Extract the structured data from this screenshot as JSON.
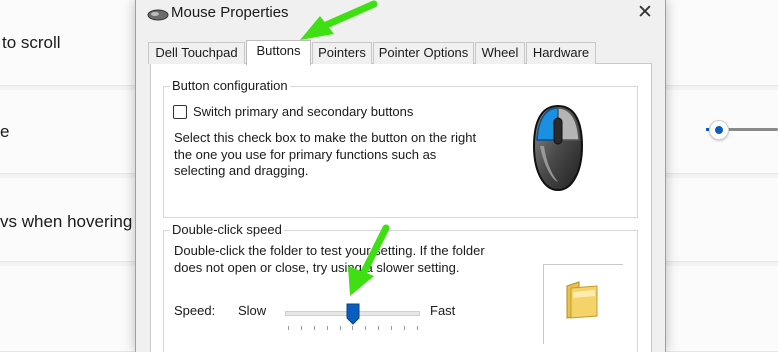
{
  "background": {
    "row1_text": "to scroll",
    "row2_text": "e",
    "row3_text": "vs when hovering o"
  },
  "dialog": {
    "title": "Mouse Properties",
    "close_label": "✕",
    "tabs": [
      {
        "label": "Dell Touchpad"
      },
      {
        "label": "Buttons"
      },
      {
        "label": "Pointers"
      },
      {
        "label": "Pointer Options"
      },
      {
        "label": "Wheel"
      },
      {
        "label": "Hardware"
      }
    ],
    "active_tab": "Buttons",
    "button_config": {
      "group_label": "Button configuration",
      "checkbox_label": "Switch primary and secondary buttons",
      "checked": false,
      "description_lines": [
        "Select this check box to make the button on the right",
        "the one you use for primary functions such as",
        "selecting and dragging."
      ]
    },
    "double_click": {
      "group_label": "Double-click speed",
      "description_lines": [
        "Double-click the folder to test your setting. If the folder",
        "does not open or close, try using a slower setting."
      ],
      "speed_label": "Speed:",
      "slow_label": "Slow",
      "fast_label": "Fast",
      "speed_value_fraction": 0.5
    }
  },
  "colors": {
    "annotation_arrow": "#3ee014",
    "accent_blue": "#0a5dc2",
    "mouse_highlight": "#1b8fe0"
  }
}
